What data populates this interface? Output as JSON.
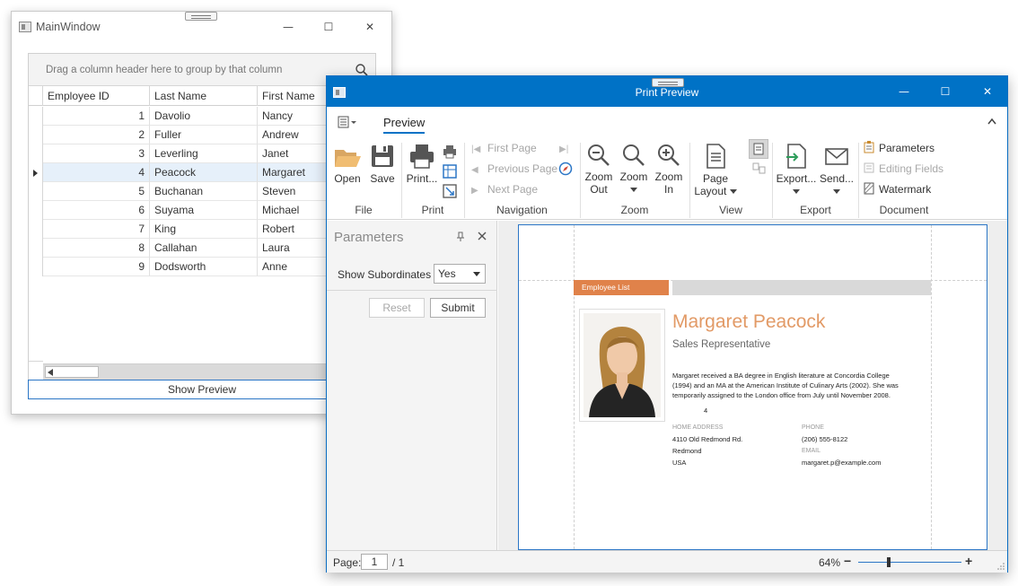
{
  "main_window": {
    "title": "MainWindow",
    "minimize": "—",
    "maximize": "☐",
    "close": "✕",
    "group_panel_text": "Drag a column header here to group by that column",
    "columns": [
      "Employee ID",
      "Last Name",
      "First Name"
    ],
    "rows": [
      {
        "id": "1",
        "last": "Davolio",
        "first": "Nancy"
      },
      {
        "id": "2",
        "last": "Fuller",
        "first": "Andrew"
      },
      {
        "id": "3",
        "last": "Leverling",
        "first": "Janet"
      },
      {
        "id": "4",
        "last": "Peacock",
        "first": "Margaret"
      },
      {
        "id": "5",
        "last": "Buchanan",
        "first": "Steven"
      },
      {
        "id": "6",
        "last": "Suyama",
        "first": "Michael"
      },
      {
        "id": "7",
        "last": "King",
        "first": "Robert"
      },
      {
        "id": "8",
        "last": "Callahan",
        "first": "Laura"
      },
      {
        "id": "9",
        "last": "Dodsworth",
        "first": "Anne"
      }
    ],
    "selected_row_index": 3,
    "show_preview_label": "Show Preview"
  },
  "print_preview": {
    "title": "Print Preview",
    "tab": "Preview",
    "groups": {
      "file": {
        "label": "File",
        "open": "Open",
        "save": "Save"
      },
      "print": {
        "label": "Print",
        "print": "Print..."
      },
      "navigation": {
        "label": "Navigation",
        "first": "First Page",
        "previous": "Previous Page",
        "next": "Next Page"
      },
      "zoom": {
        "label": "Zoom",
        "zoom_out": [
          "Zoom",
          "Out"
        ],
        "zoom": "Zoom",
        "zoom_in": [
          "Zoom",
          "In"
        ]
      },
      "view": {
        "label": "View",
        "page_layout": [
          "Page",
          "Layout"
        ]
      },
      "export": {
        "label": "Export",
        "export": "Export...",
        "send": "Send..."
      },
      "document": {
        "label": "Document",
        "parameters": "Parameters",
        "editing_fields": "Editing Fields",
        "watermark": "Watermark"
      }
    },
    "params_pane": {
      "title": "Parameters",
      "field_label": "Show Subordinates",
      "field_value": "Yes",
      "reset": "Reset",
      "submit": "Submit"
    },
    "report": {
      "band": "Employee List",
      "name": "Margaret Peacock",
      "job_title": "Sales Representative",
      "bio": [
        "Margaret received a BA degree in English literature at Concordia College",
        "(1994) and an MA at the American Institute of Culinary Arts (2002). She was",
        "temporarily assigned to the London office from July until November 2008."
      ],
      "subordinate_number": "4",
      "home_address_label": "HOME ADDRESS",
      "address": [
        "4110 Old Redmond Rd.",
        "Redmond",
        "USA"
      ],
      "phone_label": "PHONE",
      "phone": "(206) 555-8122",
      "email_label": "EMAIL",
      "email": "margaret.p@example.com"
    },
    "status": {
      "page_label": "Page:",
      "page_value": "1",
      "page_total": "/ 1",
      "zoom": "64%",
      "zoom_level": 0.28
    }
  }
}
